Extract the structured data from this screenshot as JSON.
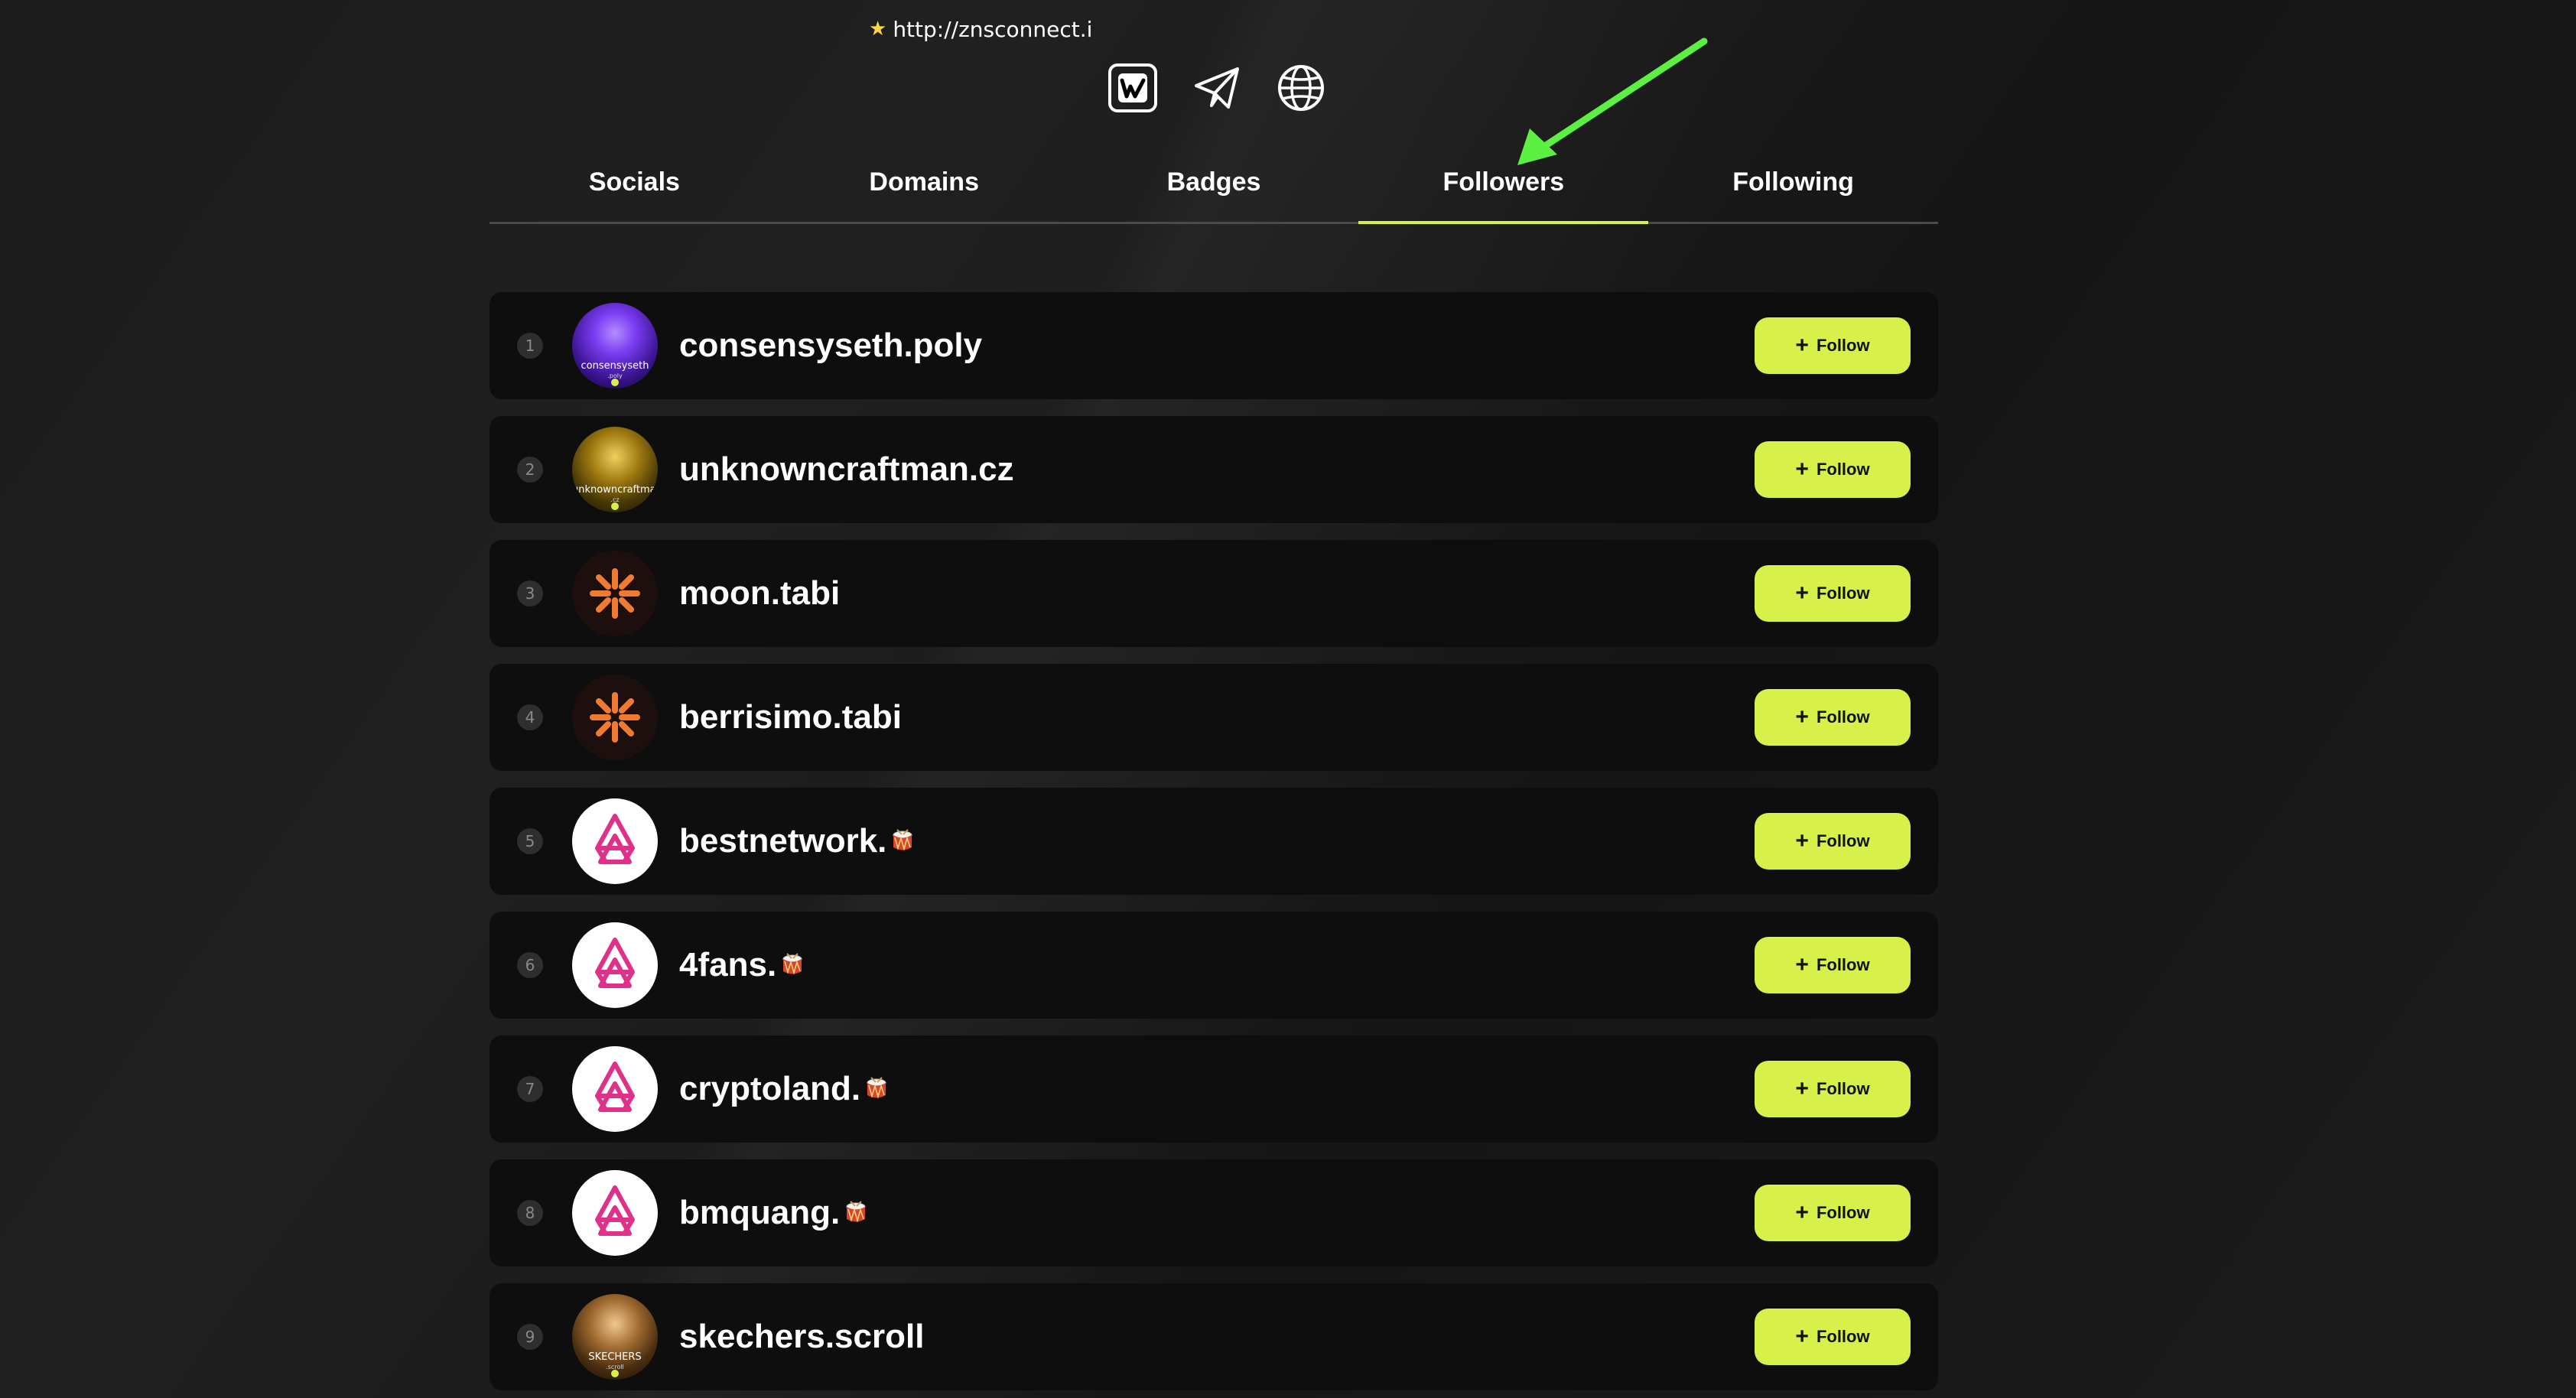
{
  "top_link": {
    "text": "http://znsconnect.i"
  },
  "tabs": [
    {
      "label": "Socials"
    },
    {
      "label": "Domains"
    },
    {
      "label": "Badges"
    },
    {
      "label": "Followers"
    },
    {
      "label": "Following"
    }
  ],
  "active_tab": "Followers",
  "followers": [
    {
      "rank": "1",
      "name": "consensyseth.poly",
      "avatar_style": "purple",
      "avatar_text": "consensyseth",
      "avatar_sub": ".poly",
      "has_drum": false
    },
    {
      "rank": "2",
      "name": "unknowncraftman.cz",
      "avatar_style": "gold",
      "avatar_text": "unknowncraftman",
      "avatar_sub": ".cz",
      "has_drum": false
    },
    {
      "rank": "3",
      "name": "moon.tabi",
      "avatar_style": "dark",
      "has_drum": false
    },
    {
      "rank": "4",
      "name": "berrisimo.tabi",
      "avatar_style": "dark",
      "has_drum": false
    },
    {
      "rank": "5",
      "name": "bestnetwork.",
      "avatar_style": "white",
      "has_drum": true
    },
    {
      "rank": "6",
      "name": "4fans.",
      "avatar_style": "white",
      "has_drum": true
    },
    {
      "rank": "7",
      "name": "cryptoland.",
      "avatar_style": "white",
      "has_drum": true
    },
    {
      "rank": "8",
      "name": "bmquang.",
      "avatar_style": "white",
      "has_drum": true
    },
    {
      "rank": "9",
      "name": "skechers.scroll",
      "avatar_style": "bronze",
      "avatar_text": "SKECHERS",
      "avatar_sub": ".scroll",
      "has_drum": false
    }
  ],
  "follow_label": "Follow",
  "colors": {
    "accent": "#d8f04a",
    "background": "#1a1a1a",
    "row": "#0e0e0e",
    "arrow": "#5cf043"
  },
  "icons": {
    "social": [
      "w-logo-icon",
      "telegram-icon",
      "globe-icon"
    ]
  }
}
